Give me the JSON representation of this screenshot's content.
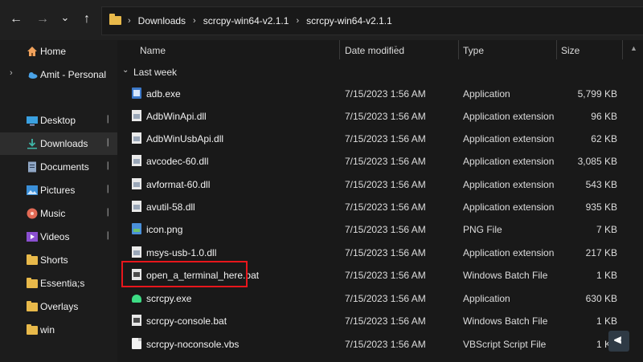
{
  "nav": {
    "back": "←",
    "forward": "→",
    "recent": "⌄",
    "up": "↑"
  },
  "address": {
    "crumbs": [
      "Downloads",
      "scrcpy-win64-v2.1.1",
      "scrcpy-win64-v2.1.1"
    ],
    "separator": "›"
  },
  "sidebar": {
    "items": [
      {
        "label": "Home",
        "icon": "home-icon"
      },
      {
        "label": "Amit - Personal",
        "icon": "cloud-icon"
      },
      {
        "label": "Desktop",
        "icon": "desktop-icon"
      },
      {
        "label": "Downloads",
        "icon": "download-icon"
      },
      {
        "label": "Documents",
        "icon": "documents-icon"
      },
      {
        "label": "Pictures",
        "icon": "pictures-icon"
      },
      {
        "label": "Music",
        "icon": "music-icon"
      },
      {
        "label": "Videos",
        "icon": "videos-icon"
      },
      {
        "label": "Shorts",
        "icon": "folder-icon"
      },
      {
        "label": "Essentia;s",
        "icon": "folder-icon"
      },
      {
        "label": "Overlays",
        "icon": "folder-icon"
      },
      {
        "label": "win",
        "icon": "folder-icon"
      }
    ]
  },
  "columns": {
    "name": "Name",
    "date": "Date modified",
    "type": "Type",
    "size": "Size"
  },
  "group": {
    "label": "Last week",
    "chevron": "⌄"
  },
  "files": [
    {
      "name": "adb.exe",
      "date": "7/15/2023 1:56 AM",
      "type": "Application",
      "size": "5,799 KB",
      "icon": "exe-icon"
    },
    {
      "name": "AdbWinApi.dll",
      "date": "7/15/2023 1:56 AM",
      "type": "Application extension",
      "size": "96 KB",
      "icon": "dll-icon"
    },
    {
      "name": "AdbWinUsbApi.dll",
      "date": "7/15/2023 1:56 AM",
      "type": "Application extension",
      "size": "62 KB",
      "icon": "dll-icon"
    },
    {
      "name": "avcodec-60.dll",
      "date": "7/15/2023 1:56 AM",
      "type": "Application extension",
      "size": "3,085 KB",
      "icon": "dll-icon"
    },
    {
      "name": "avformat-60.dll",
      "date": "7/15/2023 1:56 AM",
      "type": "Application extension",
      "size": "543 KB",
      "icon": "dll-icon"
    },
    {
      "name": "avutil-58.dll",
      "date": "7/15/2023 1:56 AM",
      "type": "Application extension",
      "size": "935 KB",
      "icon": "dll-icon"
    },
    {
      "name": "icon.png",
      "date": "7/15/2023 1:56 AM",
      "type": "PNG File",
      "size": "7 KB",
      "icon": "png-icon"
    },
    {
      "name": "msys-usb-1.0.dll",
      "date": "7/15/2023 1:56 AM",
      "type": "Application extension",
      "size": "217 KB",
      "icon": "dll-icon"
    },
    {
      "name": "open_a_terminal_here.bat",
      "date": "7/15/2023 1:56 AM",
      "type": "Windows Batch File",
      "size": "1 KB",
      "icon": "bat-icon"
    },
    {
      "name": "scrcpy.exe",
      "date": "7/15/2023 1:56 AM",
      "type": "Application",
      "size": "630 KB",
      "icon": "android-icon"
    },
    {
      "name": "scrcpy-console.bat",
      "date": "7/15/2023 1:56 AM",
      "type": "Windows Batch File",
      "size": "1 KB",
      "icon": "bat-icon"
    },
    {
      "name": "scrcpy-noconsole.vbs",
      "date": "7/15/2023 1:56 AM",
      "type": "VBScript Script File",
      "size": "1 KB",
      "icon": "vbs-icon"
    }
  ],
  "pin": "📌",
  "expand": "›"
}
